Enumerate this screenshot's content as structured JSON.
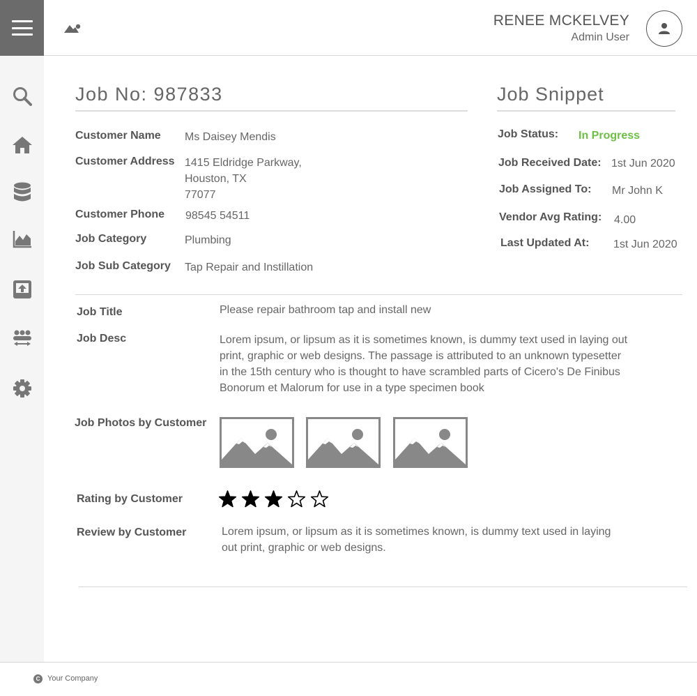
{
  "header": {
    "user_name": "RENEE MCKELVEY",
    "user_role": "Admin User",
    "icons": [
      "menu-icon",
      "logo-mountain-icon",
      "user-avatar-icon"
    ]
  },
  "sidebar": {
    "items": [
      {
        "name": "search",
        "icon": "search-icon"
      },
      {
        "name": "home",
        "icon": "home-icon"
      },
      {
        "name": "database",
        "icon": "database-icon"
      },
      {
        "name": "analytics",
        "icon": "chart-icon"
      },
      {
        "name": "upload",
        "icon": "upload-icon"
      },
      {
        "name": "users-transfer",
        "icon": "users-transfer-icon"
      },
      {
        "name": "settings",
        "icon": "gear-icon"
      }
    ]
  },
  "job": {
    "title_label": "Job No: 987833",
    "fields": {
      "customer_name_label": "Customer Name",
      "customer_name": "Ms Daisey Mendis",
      "customer_address_label": "Customer Address",
      "address_line1": "1415 Eldridge Parkway,",
      "address_line2": "Houston, TX",
      "address_line3": "77077",
      "customer_phone_label": "Customer Phone",
      "customer_phone": "98545 54511",
      "job_category_label": "Job Category",
      "job_category": "Plumbing",
      "job_sub_category_label": "Job Sub Category",
      "job_sub_category": "Tap Repair and Instillation"
    },
    "details": {
      "job_title_label": "Job Title",
      "job_title": "Please repair bathroom tap and install new",
      "job_desc_label": "Job Desc",
      "job_desc": "Lorem ipsum, or lipsum as it is sometimes known, is dummy text used in laying out print, graphic or web designs. The passage is attributed to an unknown typesetter in the 15th century who is thought to have scrambled parts of Cicero's De Finibus Bonorum et Malorum for use in a type specimen book",
      "photos_label": "Job Photos by Customer",
      "photo_count": 3,
      "rating_label": "Rating by Customer",
      "rating": 3,
      "rating_max": 5,
      "review_label": "Review by Customer",
      "review": "Lorem ipsum, or lipsum as it is sometimes known, is dummy text used in laying out print, graphic or web designs."
    }
  },
  "snippet": {
    "title": "Job Snippet",
    "status_label": "Job Status:",
    "status": "In Progress",
    "status_color": "#6cbe45",
    "received_label": "Job Received Date:",
    "received": "1st Jun 2020",
    "assigned_label": "Job Assigned To:",
    "assigned": "Mr John K",
    "rating_label": "Vendor Avg Rating:",
    "rating": "4.00",
    "updated_label": "Last Updated At:",
    "updated": "1st Jun 2020"
  },
  "footer": {
    "copyright_symbol": "C",
    "company": "Your Company"
  },
  "colors": {
    "menu_bg": "#6b6b6b",
    "sidebar_bg": "#f5f5f5",
    "text": "#555555",
    "accent_green": "#6cbe45",
    "icon_gray": "#777777"
  }
}
